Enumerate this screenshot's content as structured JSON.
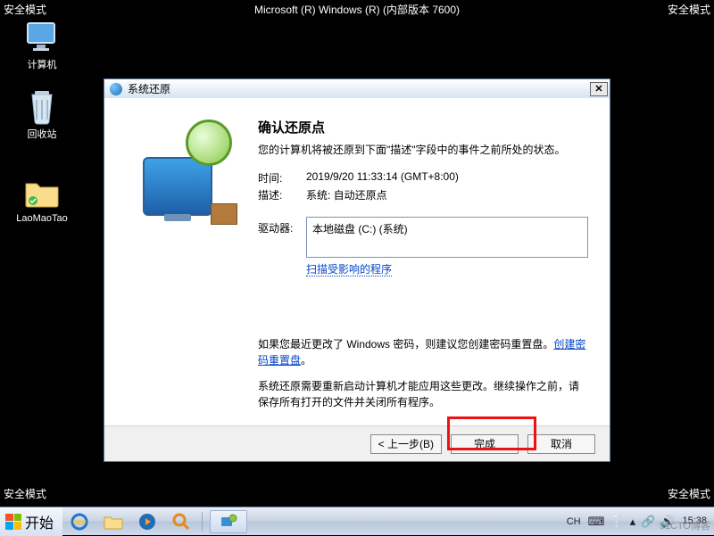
{
  "safe_mode_label": "安全模式",
  "header_title": "Microsoft (R) Windows (R) (内部版本 7600)",
  "desktop": {
    "computer": "计算机",
    "recycle": "回收站",
    "folder": "LaoMaoTao"
  },
  "dialog": {
    "title": "系统还原",
    "heading": "确认还原点",
    "intro": "您的计算机将被还原到下面\"描述\"字段中的事件之前所处的状态。",
    "time_label": "时间:",
    "time_value": "2019/9/20 11:33:14 (GMT+8:00)",
    "desc_label": "描述:",
    "desc_value": "系统: 自动还原点",
    "drives_label": "驱动器:",
    "drive_value": "本地磁盘 (C:) (系统)",
    "scan_link": "扫描受影响的程序",
    "password_note_prefix": "如果您最近更改了 Windows 密码，则建议您创建密码重置盘。",
    "password_link": "创建密码重置盘",
    "password_note_suffix": "。",
    "restart_note": "系统还原需要重新启动计算机才能应用这些更改。继续操作之前，请保存所有打开的文件并关闭所有程序。",
    "back_btn": "< 上一步(B)",
    "finish_btn": "完成",
    "cancel_btn": "取消"
  },
  "taskbar": {
    "start": "开始",
    "ime": "CH",
    "time": "15:38"
  },
  "watermark": "51CTO博客"
}
